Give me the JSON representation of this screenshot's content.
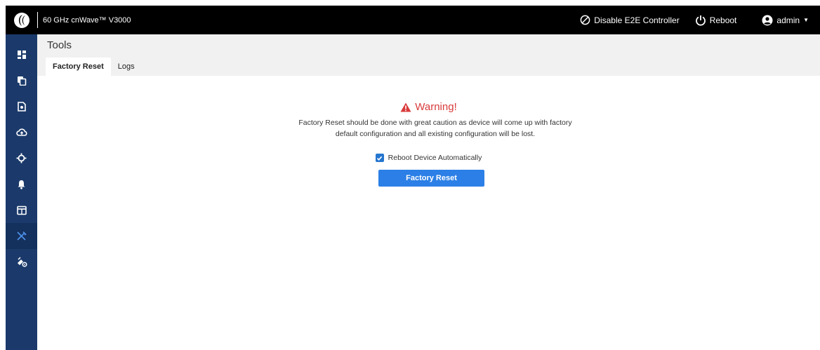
{
  "header": {
    "product_name": "60 GHz cnWave™ V3000",
    "disable_e2e_label": "Disable E2E Controller",
    "reboot_label": "Reboot",
    "user_label": "admin"
  },
  "sidebar": {
    "items": [
      {
        "icon": "dashboard-icon",
        "active": false
      },
      {
        "icon": "copy-icon",
        "active": false
      },
      {
        "icon": "file-settings-icon",
        "active": false
      },
      {
        "icon": "cloud-upload-icon",
        "active": false
      },
      {
        "icon": "crosshair-icon",
        "active": false
      },
      {
        "icon": "bell-icon",
        "active": false
      },
      {
        "icon": "table-icon",
        "active": false
      },
      {
        "icon": "tools-icon",
        "active": true
      },
      {
        "icon": "satellite-settings-icon",
        "active": false
      }
    ]
  },
  "page": {
    "title": "Tools",
    "tabs": [
      {
        "label": "Factory Reset",
        "active": true
      },
      {
        "label": "Logs",
        "active": false
      }
    ]
  },
  "factory_reset": {
    "warning_title": "Warning!",
    "warning_line1": "Factory Reset should be done with great caution as device will come up with factory",
    "warning_line2": "default configuration and all existing configuration will be lost.",
    "reboot_checkbox_label": "Reboot Device Automatically",
    "reboot_checked": true,
    "button_label": "Factory Reset"
  },
  "colors": {
    "topbar": "#000000",
    "sidebar": "#1b3a6b",
    "warning": "#d93a3a",
    "primary_button": "#2b7fe6"
  }
}
